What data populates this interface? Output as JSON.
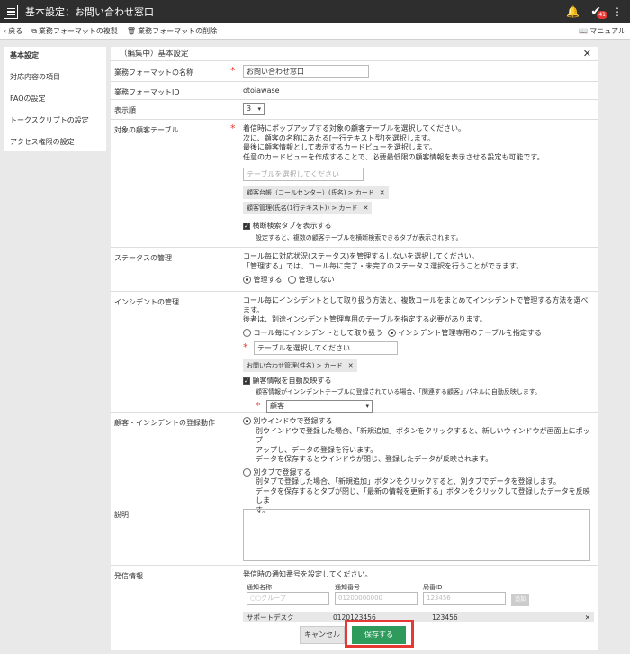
{
  "titlebar": {
    "title": "基本設定：お問い合わせ窓口",
    "badge": "41"
  },
  "toolbar": {
    "back": "戻る",
    "duplicate": "業務フォーマットの複製",
    "delete": "業務フォーマットの削除",
    "manual": "マニュアル"
  },
  "sidebar": {
    "items": [
      {
        "label": "基本設定"
      },
      {
        "label": "対応内容の項目"
      },
      {
        "label": "FAQの設定"
      },
      {
        "label": "トークスクリプトの設定"
      },
      {
        "label": "アクセス権限の設定"
      }
    ]
  },
  "panel": {
    "title": "（編集中）基本設定"
  },
  "rows": {
    "name": {
      "label": "業務フォーマットの名称",
      "value": "お問い合わせ窓口"
    },
    "id": {
      "label": "業務フォーマットID",
      "value": "otoiawase"
    },
    "order": {
      "label": "表示順",
      "value": "3"
    },
    "tables": {
      "label": "対象の顧客テーブル",
      "desc1": "着信時にポップアップする対象の顧客テーブルを選択してください。",
      "desc2": "次に、顧客の名称にあたる[一行テキスト型]を選択します。",
      "desc3": "最後に顧客情報として表示するカードビューを選択します。",
      "desc4": "任意のカードビューを作成することで、必要最低限の顧客情報を表示させる設定も可能です。",
      "placeholder": "テーブルを選択してください",
      "chip1": "顧客台帳（コールセンター）(氏名) > カード",
      "chip2": "顧客管理(氏名(1行テキスト)) > カード",
      "cb_label": "横断検索タブを表示する",
      "cb_note": "設定すると、複数の顧客テーブルを横断検索できるタブが表示されます。"
    },
    "status": {
      "label": "ステータスの管理",
      "desc1": "コール毎に対応状況(ステータス)を管理するしないを選択してください。",
      "desc2": "「管理する」では、コール毎に完了・未完了のステータス選択を行うことができます。",
      "opt1": "管理する",
      "opt2": "管理しない"
    },
    "incident": {
      "label": "インシデントの管理",
      "desc1": "コール毎にインシデントとして取り扱う方法と、複数コールをまとめてインシデントで管理する方法を選べます。",
      "desc2": "後者は、別途インシデント管理専用のテーブルを指定する必要があります。",
      "opt1": "コール毎にインシデントとして取り扱う",
      "opt2": "インシデント管理専用のテーブルを指定する",
      "placeholder": "テーブルを選択してください",
      "chip": "お問い合わせ管理(件名) > カード",
      "cb_label": "顧客情報を自動反映する",
      "cb_note": "顧客情報がインシデントテーブルに登録されている場合、「関連する顧客」パネルに自動反映します。",
      "select": "顧客"
    },
    "register": {
      "label": "顧客・インシデントの登録動作",
      "opt1": "別ウインドウで登録する",
      "opt1_d1": "別ウインドウで登録した場合、「新規追加」ボタンをクリックすると、新しいウインドウが画面上にポップ",
      "opt1_d2": "アップし、データの登録を行います。",
      "opt1_d3": "データを保存するとウインドウが閉じ、登録したデータが反映されます。",
      "opt2": "別タブで登録する",
      "opt2_d1": "別タブで登録した場合、「新規追加」ボタンをクリックすると、別タブでデータを登録します。",
      "opt2_d2": "データを保存するとタブが閉じ、「最新の情報を更新する」ボタンをクリックして登録したデータを反映しま",
      "opt2_d3": "す。"
    },
    "desc": {
      "label": "説明"
    },
    "notify": {
      "label": "発信情報",
      "desc": "発信時の通知番号を設定してください。",
      "col1": "通知名称",
      "col2": "通知番号",
      "col3": "局番ID",
      "ph1": "○○グループ",
      "ph2": "01200000000",
      "ph3": "123456",
      "add": "追加",
      "entry_name": "サポートデスク",
      "entry_number": "0120123456",
      "entry_id": "123456"
    }
  },
  "footer": {
    "cancel": "キャンセル",
    "save": "保存する"
  },
  "colors": {
    "accent": "#2e9a5c",
    "required": "#e53935",
    "highlight": "#e53935"
  }
}
